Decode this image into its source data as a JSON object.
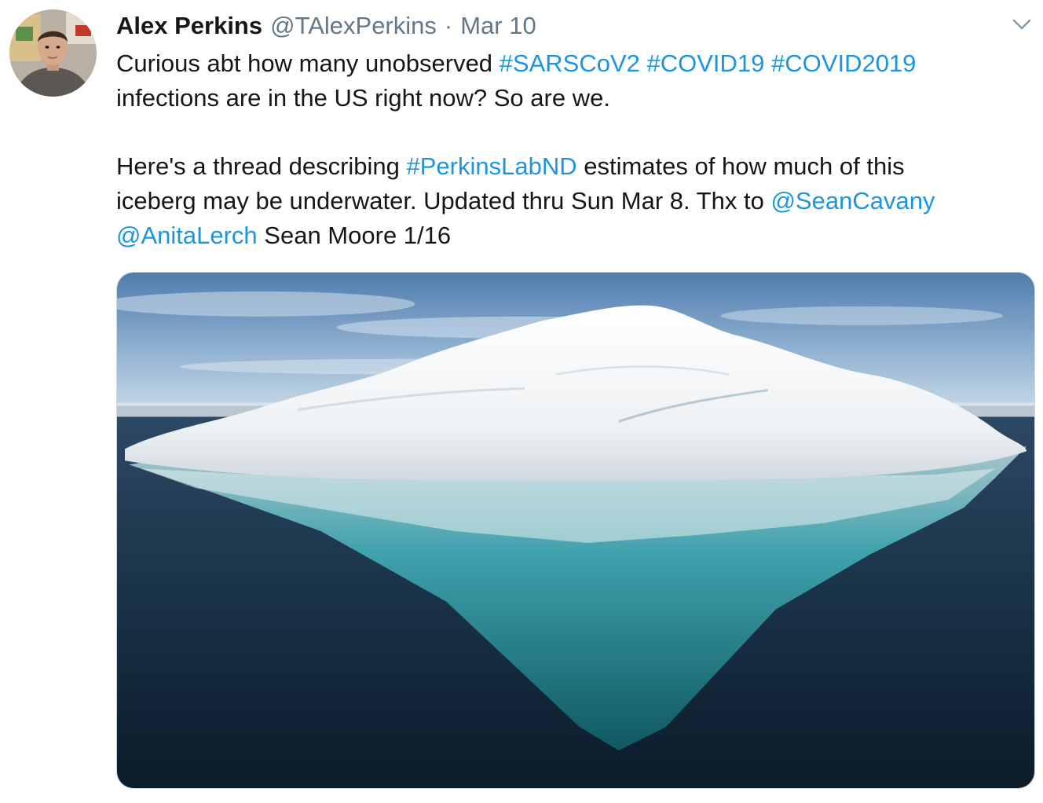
{
  "tweet": {
    "author": {
      "display_name": "Alex Perkins",
      "handle": "@TAlexPerkins"
    },
    "separator": "·",
    "date": "Mar 10",
    "text": {
      "line1": {
        "prefix": "Curious abt how many unobserved ",
        "hashtag1": "#SARSCoV2",
        "hashtag2": "#COVID19",
        "hashtag3": "#COVID2019"
      },
      "line2": "infections are in the US right now? So are we.",
      "line3": {
        "prefix": "Here's a thread describing ",
        "hashtag": "#PerkinsLabND",
        "suffix": " estimates of how much of this"
      },
      "line4": {
        "prefix": "iceberg may be underwater. Updated thru Sun Mar 8. Thx to ",
        "mention": "@SeanCavany"
      },
      "line5": {
        "mention": "@AnitaLerch",
        "suffix": " Sean Moore 1/16"
      }
    },
    "media": {
      "kind": "photo",
      "subject": "iceberg"
    }
  },
  "icons": {
    "menu": "chevron-down-icon"
  },
  "colors": {
    "link": "#1b95e0",
    "text": "#14171a",
    "secondary": "#657786"
  }
}
